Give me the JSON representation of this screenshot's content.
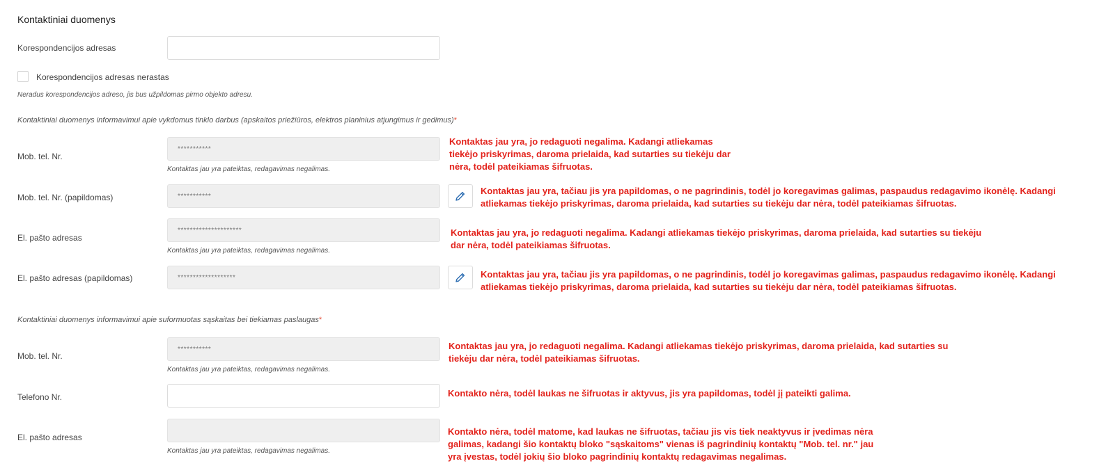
{
  "section": {
    "title": "Kontaktiniai duomenys",
    "correspondence_label": "Korespondencijos adresas",
    "correspondence_value": "",
    "checkbox_label": "Korespondencijos adresas nerastas",
    "checkbox_note": "Neradus korespondencijos adreso, jis bus užpildomas pirmo objekto adresu."
  },
  "group1": {
    "title": "Kontaktiniai duomenys informavimui apie vykdomus tinklo darbus (apskaitos priežiūros, elektros planinius atjungimus ir gedimus)",
    "required_mark": "*",
    "rows": [
      {
        "label": "Mob. tel. Nr.",
        "value": "***********",
        "hint": "Kontaktas jau yra pateiktas, redagavimas negalimas."
      },
      {
        "label": "Mob. tel. Nr. (papildomas)",
        "value": "***********"
      },
      {
        "label": "El. pašto adresas",
        "value": "*********************",
        "hint": "Kontaktas jau yra pateiktas, redagavimas negalimas."
      },
      {
        "label": "El. pašto adresas (papildomas)",
        "value": "*******************"
      }
    ]
  },
  "group2": {
    "title": "Kontaktiniai duomenys informavimui apie suformuotas sąskaitas bei tiekiamas paslaugas",
    "required_mark": "*",
    "rows": [
      {
        "label": "Mob. tel. Nr.",
        "value": "***********",
        "hint": "Kontaktas jau yra pateiktas, redagavimas negalimas."
      },
      {
        "label": "Telefono Nr.",
        "value": ""
      },
      {
        "label": "El. pašto adresas",
        "value": "",
        "hint": "Kontaktas jau yra pateiktas, redagavimas negalimas."
      }
    ]
  },
  "annotations": [
    "Kontaktas jau yra, jo redaguoti negalima. Kadangi atliekamas tiekėjo priskyrimas, daroma prielaida, kad sutarties su tiekėju dar nėra, todėl pateikiamas šifruotas.",
    "Kontaktas jau yra, tačiau jis yra papildomas, o ne pagrindinis, todėl jo koregavimas galimas, paspaudus redagavimo ikonėlę. Kadangi atliekamas tiekėjo priskyrimas, daroma prielaida, kad sutarties su tiekėju dar nėra, todėl pateikiamas šifruotas.",
    "Kontaktas jau yra, jo redaguoti negalima. Kadangi atliekamas tiekėjo priskyrimas, daroma prielaida, kad sutarties su tiekėju dar nėra, todėl pateikiamas šifruotas.",
    "Kontaktas jau yra, tačiau jis yra papildomas, o ne pagrindinis, todėl jo koregavimas galimas, paspaudus redagavimo ikonėlę. Kadangi atliekamas tiekėjo priskyrimas, daroma prielaida, kad sutarties su tiekėju dar nėra, todėl pateikiamas šifruotas.",
    "Kontaktas jau yra, jo redaguoti negalima. Kadangi atliekamas tiekėjo priskyrimas, daroma prielaida, kad sutarties su tiekėju dar nėra, todėl pateikiamas šifruotas.",
    "Kontakto nėra, todėl laukas ne šifruotas ir aktyvus,  jis yra papildomas, todėl jį pateikti galima.",
    "Kontakto nėra, todėl matome, kad laukas ne šifruotas, tačiau jis vis tiek neaktyvus ir įvedimas nėra galimas, kadangi šio kontaktų bloko \"sąskaitoms\" vienas iš pagrindinių kontaktų \"Mob. tel. nr.\" jau yra įvestas, todėl jokių šio bloko pagrindinių kontaktų redagavimas negalimas."
  ],
  "colors": {
    "annotation": "#e3231c",
    "required": "#e5533d",
    "edit_icon": "#2f6fb3"
  }
}
